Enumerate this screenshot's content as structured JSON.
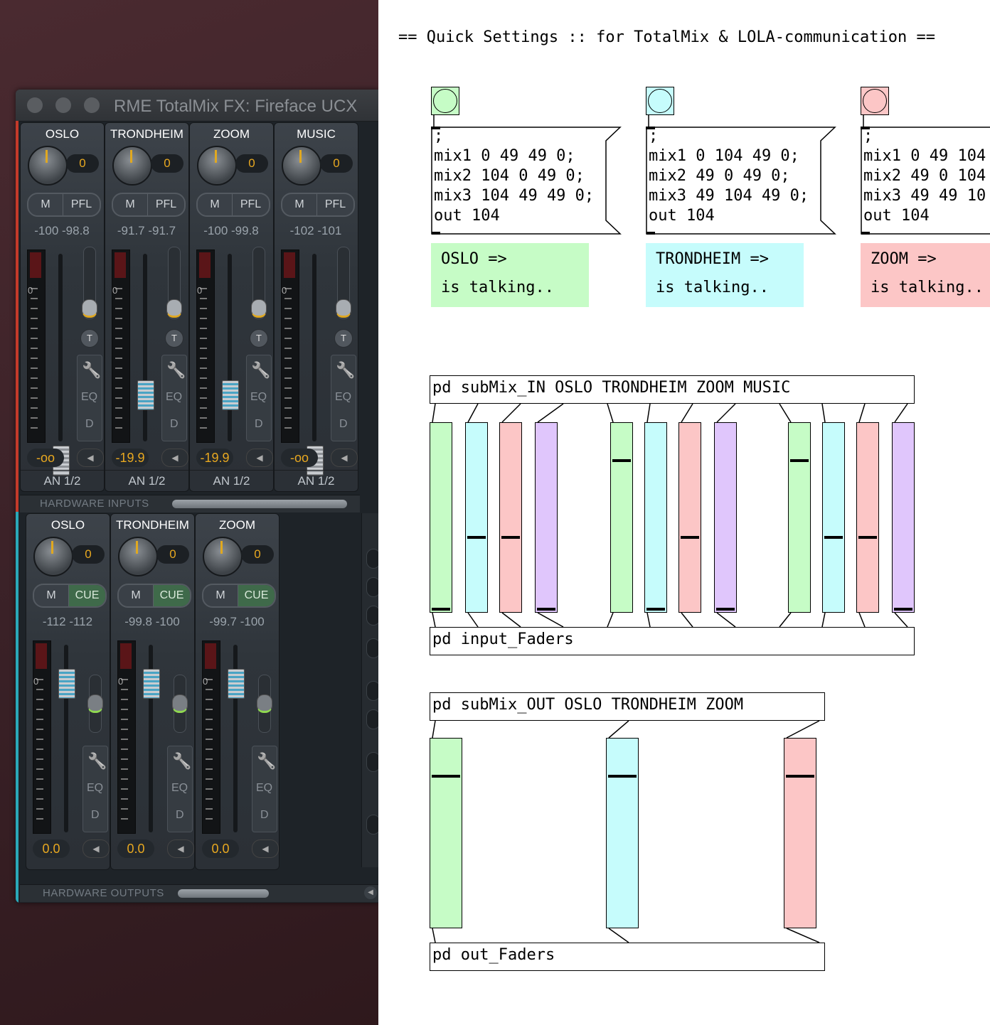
{
  "totalmix": {
    "window_title": "RME TotalMix FX: Fireface UCX",
    "inputs": [
      {
        "name": "OSLO",
        "knob": "0",
        "btn1": "M",
        "btn2": "PFL",
        "peak": "-100 -98.8",
        "gain": "-oo",
        "route": "AN 1/2"
      },
      {
        "name": "TRONDHEIM",
        "knob": "0",
        "btn1": "M",
        "btn2": "PFL",
        "peak": "-91.7 -91.7",
        "gain": "-19.9",
        "route": "AN 1/2"
      },
      {
        "name": "ZOOM",
        "knob": "0",
        "btn1": "M",
        "btn2": "PFL",
        "peak": "-100 -99.8",
        "gain": "-19.9",
        "route": "AN 1/2"
      },
      {
        "name": "MUSIC",
        "knob": "0",
        "btn1": "M",
        "btn2": "PFL",
        "peak": "-102 -101",
        "gain": "-oo",
        "route": "AN 1/2"
      }
    ],
    "inputs_section_label": "HARDWARE INPUTS",
    "outputs": [
      {
        "name": "OSLO",
        "knob": "0",
        "btn1": "M",
        "btn2": "CUE",
        "peak": "-112 -112",
        "gain": "0.0"
      },
      {
        "name": "TRONDHEIM",
        "knob": "0",
        "btn1": "M",
        "btn2": "CUE",
        "peak": "-99.8 -100",
        "gain": "0.0"
      },
      {
        "name": "ZOOM",
        "knob": "0",
        "btn1": "M",
        "btn2": "CUE",
        "peak": "-99.7 -100",
        "gain": "0.0"
      }
    ],
    "outputs_section_label": "HARDWARE OUTPUTS",
    "strip_labels": {
      "zero": "0",
      "t": "T",
      "eq": "EQ",
      "d": "D"
    }
  },
  "pd": {
    "title": "== Quick Settings :: for TotalMix & LOLA-communication ==",
    "presets": [
      {
        "color": "#c6fcc6",
        "lines": [
          ";",
          "mix1 0 49 49 0;",
          "mix2 104 0 49 0;",
          "mix3 104 49 49 0;",
          "out 104"
        ],
        "comment": [
          "OSLO =>",
          "is talking.."
        ]
      },
      {
        "color": "#c6fcfc",
        "lines": [
          ";",
          "mix1 0 104 49 0;",
          "mix2 49 0 49 0;",
          "mix3 49 104 49 0;",
          "out 104"
        ],
        "comment": [
          "TRONDHEIM =>",
          "is talking.."
        ]
      },
      {
        "color": "#fcc6c6",
        "lines": [
          ";",
          "mix1 0 49 104",
          "mix2 49 0 104",
          "mix3 49 49 10",
          "out 104"
        ],
        "comment": [
          "ZOOM =>",
          "is talking.."
        ]
      }
    ],
    "objects": {
      "submix_in": "pd subMix_IN OSLO TRONDHEIM ZOOM MUSIC",
      "input_faders": "pd input_Faders",
      "submix_out": "pd subMix_OUT OSLO TRONDHEIM ZOOM",
      "out_faders": "pd out_Faders"
    },
    "slider_colors": {
      "green": "#c6fcc6",
      "cyan": "#c6fcfc",
      "pink": "#fcc6c6",
      "purple": "#e0c6fc"
    },
    "input_sliders": [
      {
        "color": "green",
        "level": 0.0
      },
      {
        "color": "cyan",
        "level": 0.39
      },
      {
        "color": "pink",
        "level": 0.39
      },
      {
        "color": "purple",
        "level": 0.0
      },
      {
        "color": "green",
        "level": 0.81
      },
      {
        "color": "cyan",
        "level": 0.0
      },
      {
        "color": "pink",
        "level": 0.39
      },
      {
        "color": "purple",
        "level": 0.0
      },
      {
        "color": "green",
        "level": 0.81
      },
      {
        "color": "cyan",
        "level": 0.39
      },
      {
        "color": "pink",
        "level": 0.39
      },
      {
        "color": "purple",
        "level": 0.0
      }
    ],
    "output_sliders": [
      {
        "color": "green",
        "level": 0.81
      },
      {
        "color": "cyan",
        "level": 0.81
      },
      {
        "color": "pink",
        "level": 0.81
      }
    ]
  }
}
